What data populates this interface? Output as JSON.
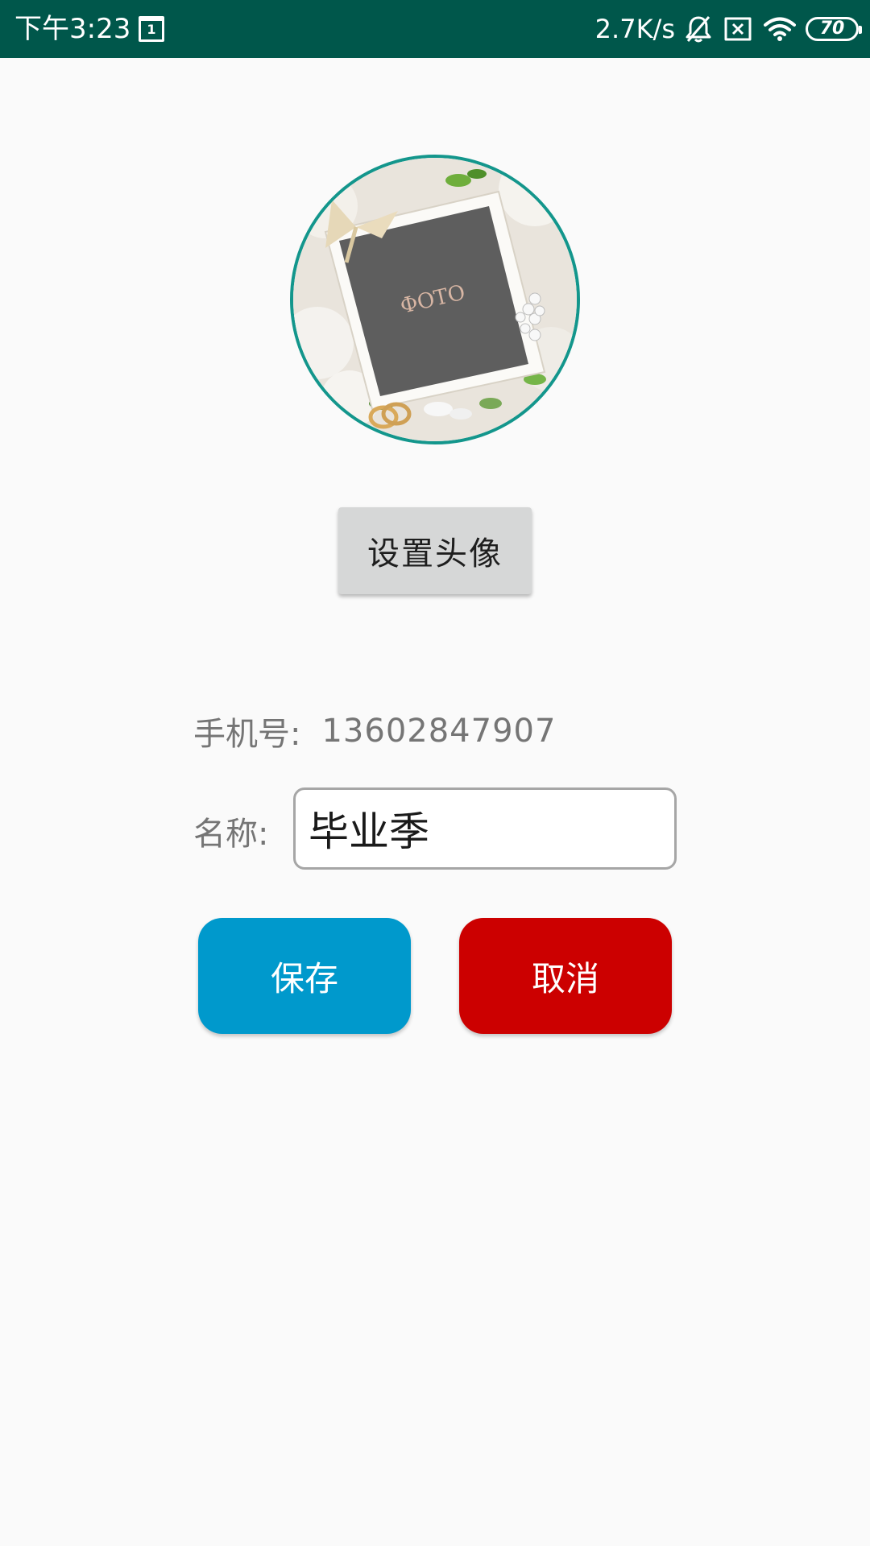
{
  "status_bar": {
    "time": "下午3:23",
    "calendar_day": "1",
    "net_speed": "2.7K/s",
    "battery_level": "70",
    "icons": [
      "calendar-icon",
      "bell-muted-icon",
      "sim-blocked-icon",
      "wifi-icon",
      "battery-icon"
    ],
    "background_color": "#00574b"
  },
  "avatar": {
    "photo_caption": "ФОТО",
    "border_color": "#13968c"
  },
  "set_avatar_button": {
    "label": "设置头像"
  },
  "phone": {
    "label": "手机号:",
    "value": "13602847907"
  },
  "name": {
    "label": "名称:",
    "value": "毕业季"
  },
  "actions": {
    "save_label": "保存",
    "cancel_label": "取消",
    "save_color": "#0099cc",
    "cancel_color": "#cc0000"
  }
}
